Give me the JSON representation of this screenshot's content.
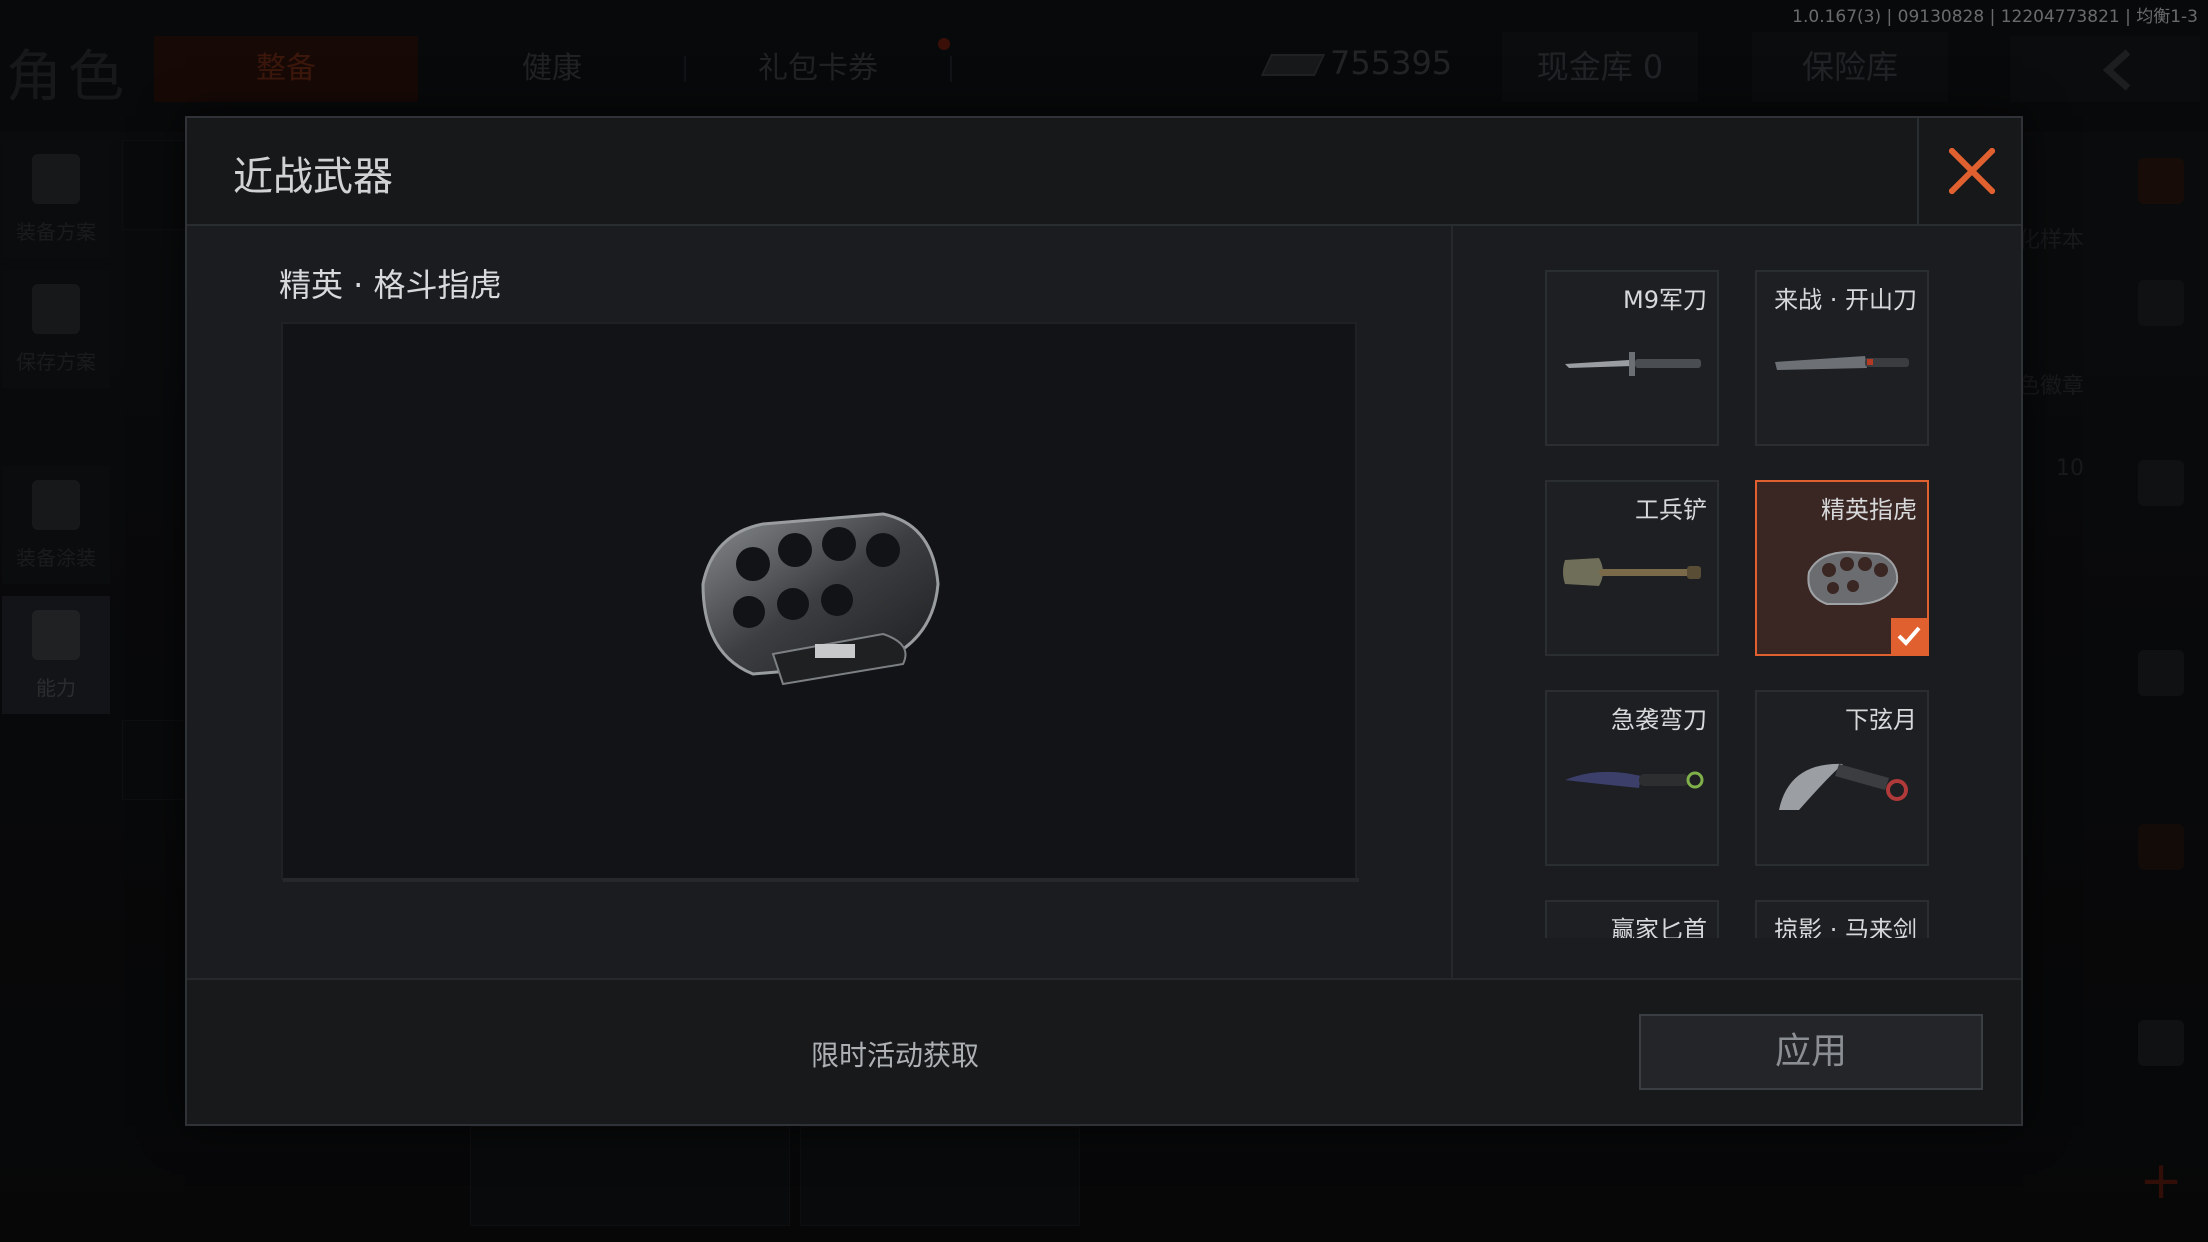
{
  "version_text": "1.0.167(3) | 09130828 | 12204773821 | 均衡1-3",
  "background": {
    "title": "角色",
    "tabs": [
      {
        "label": "整备",
        "active": true
      },
      {
        "label": "健康",
        "active": false
      },
      {
        "label": "礼包卡券",
        "active": false
      }
    ],
    "currency_value": "755395",
    "cash_vault": "现金库 0",
    "safe_box": "保险库",
    "left_rail": [
      "装备方案",
      "保存方案",
      "装备涂装",
      "能力"
    ],
    "right_side_texts": [
      "化样本",
      "色徽章",
      "10"
    ]
  },
  "modal": {
    "title": "近战武器",
    "selected_item_name": "精英 · 格斗指虎",
    "weapons": [
      {
        "name": "M9军刀",
        "icon": "bayonet-icon",
        "selected": false
      },
      {
        "name": "来战 · 开山刀",
        "icon": "machete-icon",
        "selected": false
      },
      {
        "name": "工兵铲",
        "icon": "shovel-icon",
        "selected": false
      },
      {
        "name": "精英指虎",
        "icon": "brass-knuckles-icon",
        "selected": true
      },
      {
        "name": "急袭弯刀",
        "icon": "curved-knife-icon",
        "selected": false
      },
      {
        "name": "下弦月",
        "icon": "karambit-icon",
        "selected": false
      },
      {
        "name": "赢家匕首",
        "icon": "dagger-icon",
        "selected": false
      },
      {
        "name": "掠影 · 马来剑",
        "icon": "kris-icon",
        "selected": false
      }
    ],
    "acquire_text": "限时活动获取",
    "apply_label": "应用"
  },
  "colors": {
    "accent": "#e0612f",
    "modal_bg": "#1a1c1f"
  }
}
